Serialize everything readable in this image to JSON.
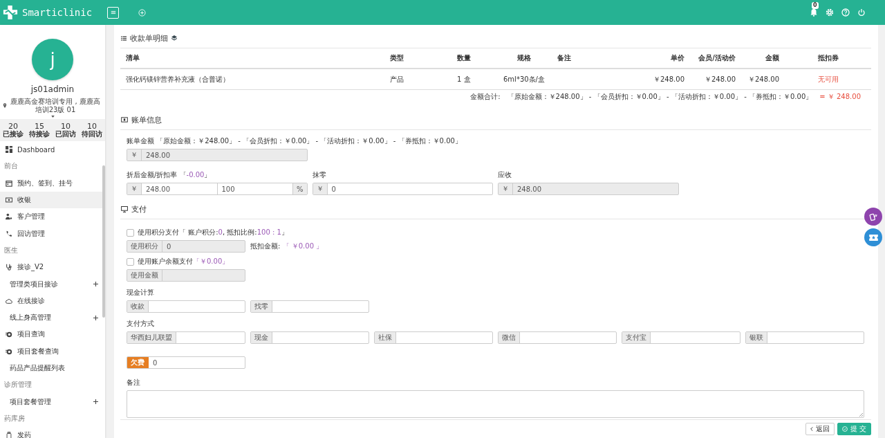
{
  "header": {
    "logo": "Smarticlinic",
    "notification_count": "0"
  },
  "profile": {
    "avatar_letter": "j",
    "username": "js01admin",
    "location": "鹿鹿高金赛培训专用 , 鹿鹿高培训23版 01"
  },
  "stats": [
    {
      "value": "20",
      "label": "已接诊"
    },
    {
      "value": "15",
      "label": "待接诊"
    },
    {
      "value": "10",
      "label": "已回访"
    },
    {
      "value": "10",
      "label": "待回访"
    }
  ],
  "nav": [
    {
      "kind": "item",
      "label": "Dashboard",
      "selected": false
    },
    {
      "kind": "section",
      "label": "前台"
    },
    {
      "kind": "item",
      "label": "预约、签到、挂号",
      "selected": false
    },
    {
      "kind": "item",
      "label": "收银",
      "selected": true
    },
    {
      "kind": "item",
      "label": "客户管理",
      "selected": false
    },
    {
      "kind": "item",
      "label": "回访管理",
      "selected": false
    },
    {
      "kind": "section",
      "label": "医生"
    },
    {
      "kind": "item",
      "label": "接诊_V2",
      "selected": false
    },
    {
      "kind": "group",
      "label": "管理类项目接诊",
      "selected": false
    },
    {
      "kind": "item",
      "label": "在线接诊",
      "selected": false
    },
    {
      "kind": "group",
      "label": "线上身高管理",
      "selected": false
    },
    {
      "kind": "item",
      "label": "项目查询",
      "selected": false
    },
    {
      "kind": "item",
      "label": "项目套餐查询",
      "selected": false
    },
    {
      "kind": "leaf",
      "label": "药品产品提醒列表",
      "selected": false
    },
    {
      "kind": "section",
      "label": "诊所管理"
    },
    {
      "kind": "group",
      "label": "项目套餐管理",
      "selected": false
    },
    {
      "kind": "section",
      "label": "药库房"
    },
    {
      "kind": "item",
      "label": "发药",
      "selected": false
    }
  ],
  "detail": {
    "title": "收款单明细",
    "table": {
      "columns": [
        "清单",
        "类型",
        "数量",
        "规格",
        "备注",
        "单价",
        "会员/活动价",
        "金额",
        "抵扣券"
      ],
      "rows": [
        [
          "强化钙镁锌营养补充液（合普诺）",
          "产品",
          "1 盒",
          "6ml*30条/盒",
          "",
          "￥248.00",
          "￥248.00",
          "￥248.00",
          "无可用"
        ]
      ]
    },
    "total_label": "金额合计:",
    "total_breakdown": "「原始金额：￥248.00」 - 「会员折扣：￥0.00」 - 「活动折扣：￥0.00」 - 「券抵扣：￥0.00」",
    "total_result": "= ￥ 248.00"
  },
  "bill": {
    "title": "账单信息",
    "amount_label": "账单金额 「原始金额：￥248.00」 - 「会员折扣：￥0.00」 - 「活动折扣：￥0.00」 - 「券抵扣：￥0.00」",
    "currency": "￥",
    "amount": "248.00",
    "discount_label": [
      {
        "kind": "plain",
        "text": "折后金额/折扣率 「"
      },
      {
        "kind": "value",
        "text": "-0.00"
      },
      {
        "kind": "plain",
        "text": "」"
      }
    ],
    "discount_amount": "248.00",
    "discount_rate": "100",
    "percent": "%",
    "rounding_label": "抹零",
    "rounding": "0",
    "receivable_label": "应收",
    "receivable": "248.00"
  },
  "payment": {
    "title": "支付",
    "points": {
      "checked": false,
      "label": [
        {
          "kind": "plain",
          "text": "使用积分支付「 账户积分:"
        },
        {
          "kind": "value",
          "text": "0"
        },
        {
          "kind": "plain",
          "text": ", 抵扣比例:"
        },
        {
          "kind": "value",
          "text": "100 : 1"
        },
        {
          "kind": "plain",
          "text": "」"
        }
      ],
      "field_label": "使用积分",
      "value": "0",
      "deduct_label": [
        {
          "kind": "plain",
          "text": "抵扣金额: "
        },
        {
          "kind": "value",
          "text": "「 ￥0.00 」"
        }
      ]
    },
    "balance": {
      "checked": false,
      "label": [
        {
          "kind": "plain",
          "text": "使用账户余额支付"
        },
        {
          "kind": "value",
          "text": "「￥0.00」"
        }
      ],
      "field_label": "使用金额"
    },
    "cash_title": "现金计算",
    "cash_fields": [
      {
        "label": "收款"
      },
      {
        "label": "找零"
      }
    ],
    "methods_title": "支付方式",
    "methods": [
      {
        "label": "华西妇儿联盟"
      },
      {
        "label": "现金"
      },
      {
        "label": "社保"
      },
      {
        "label": "微信"
      },
      {
        "label": "支付宝"
      },
      {
        "label": "银联"
      }
    ],
    "debt_label": "欠费",
    "debt": "0",
    "notes_label": "备注"
  },
  "footer": {
    "back": "返回",
    "submit": "提 交"
  }
}
